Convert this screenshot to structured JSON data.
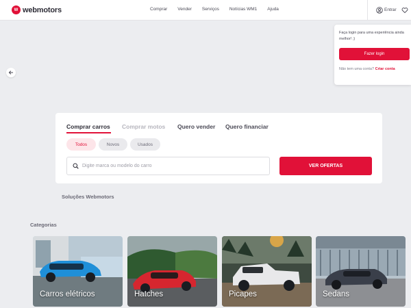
{
  "header": {
    "logo_mark": "W",
    "logo_text": "webmotors",
    "nav": [
      "Comprar",
      "Vender",
      "Serviços",
      "Notícias WM1",
      "Ajuda"
    ],
    "login_label": "Entrar"
  },
  "login_popover": {
    "message": "Faça login para uma experiência ainda melhor! ;)",
    "button_label": "Fazer login",
    "signup_prompt": "Não tem uma conta?",
    "signup_link": "Criar conta"
  },
  "search": {
    "tabs": [
      "Comprar carros",
      "Comprar motos",
      "Quero vender",
      "Quero financiar"
    ],
    "active_tab": "Comprar carros",
    "conditions": [
      "Todos",
      "Novos",
      "Usados"
    ],
    "active_condition": "Todos",
    "placeholder": "Digite marca ou modelo do carro",
    "cta_label": "VER OFERTAS"
  },
  "sections": {
    "solutions_title": "Soluções Webmotors",
    "categories_title": "Categorias"
  },
  "categories": [
    {
      "label": "Carros elétricos",
      "color": "#1f8fd8"
    },
    {
      "label": "Hatches",
      "color": "#d6262f"
    },
    {
      "label": "Picapes",
      "color": "#e8e8ea"
    },
    {
      "label": "Sedans",
      "color": "#3a3f4a"
    }
  ],
  "colors": {
    "brand": "#e11138",
    "background": "#ecedf0"
  }
}
